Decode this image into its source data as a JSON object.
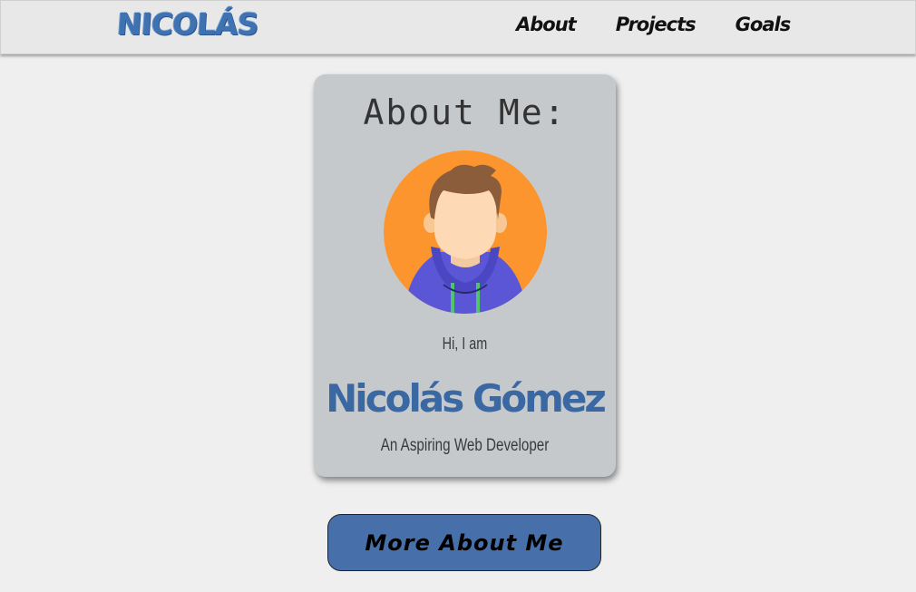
{
  "header": {
    "logo_text": "NICOLÁS",
    "nav": [
      {
        "label": "About"
      },
      {
        "label": "Projects"
      },
      {
        "label": "Goals"
      }
    ]
  },
  "about_card": {
    "title": "About Me:",
    "avatar_icon": "user-avatar-illustration",
    "greeting": "Hi, I am",
    "name": "Nicolás Gómez",
    "role": "An Aspiring Web Developer"
  },
  "cta": {
    "label": "More About Me"
  },
  "colors": {
    "accent_blue": "#4770ab",
    "name_blue": "#3a68a3",
    "avatar_orange": "#fc952d",
    "hoodie_purple": "#5a56d6",
    "card_gray": "#c6c9cc",
    "page_bg": "#efefef"
  }
}
